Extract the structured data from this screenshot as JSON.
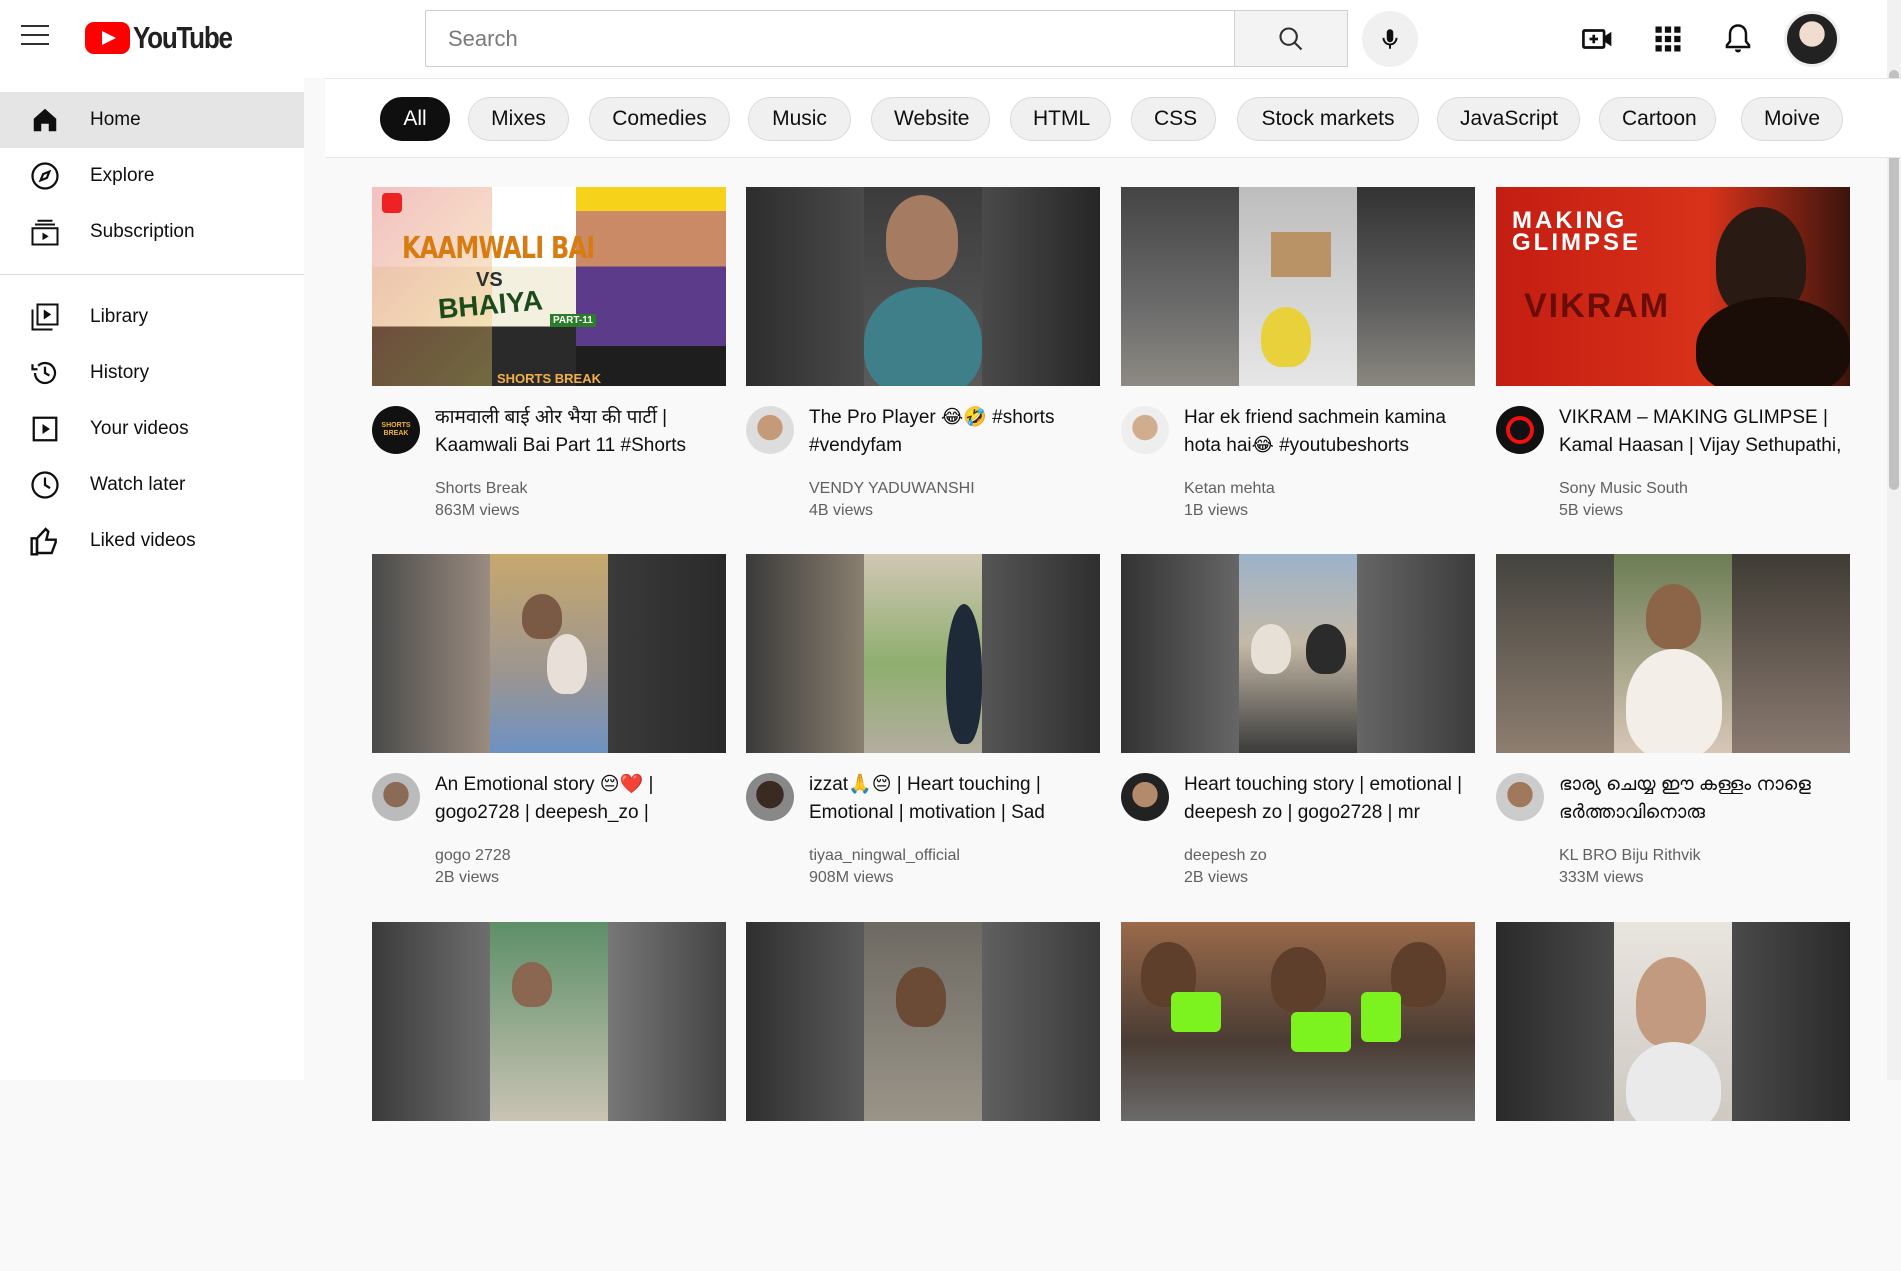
{
  "app": {
    "logo_text": "YouTube",
    "brand_color": "#ff0000"
  },
  "header": {
    "search_placeholder": "Search",
    "icons": [
      "menu-icon",
      "search-icon",
      "microphone-icon",
      "create-video-icon",
      "apps-grid-icon",
      "notifications-bell-icon",
      "account-avatar"
    ]
  },
  "sidebar": {
    "items": [
      {
        "label": "Home",
        "icon": "home-icon",
        "active": true
      },
      {
        "label": "Explore",
        "icon": "compass-icon"
      },
      {
        "label": "Subscription",
        "icon": "subscriptions-icon"
      },
      {
        "label": "Library",
        "icon": "library-icon"
      },
      {
        "label": "History",
        "icon": "history-icon"
      },
      {
        "label": "Your videos",
        "icon": "your-videos-icon"
      },
      {
        "label": "Watch later",
        "icon": "clock-icon"
      },
      {
        "label": "Liked videos",
        "icon": "thumbs-up-icon"
      }
    ]
  },
  "chips": [
    {
      "label": "All",
      "active": true
    },
    {
      "label": "Mixes"
    },
    {
      "label": "Comedies"
    },
    {
      "label": "Music"
    },
    {
      "label": "Website"
    },
    {
      "label": "HTML"
    },
    {
      "label": "CSS"
    },
    {
      "label": "Stock markets"
    },
    {
      "label": "JavaScript"
    },
    {
      "label": "Cartoon"
    },
    {
      "label": "Moive"
    }
  ],
  "videos": [
    {
      "title": "कामवाली बाई ओर भैया की पार्टी | Kaamwali Bai Part 11 #Shorts",
      "channel": "Shorts Break",
      "views": "863M views",
      "thumb_text": [
        "KAAMWALI BAI",
        "VS",
        "BHAIYA",
        "PART-11",
        "SHORTS BREAK"
      ],
      "avatar_text": "SHORTS BREAK"
    },
    {
      "title": "The Pro Player 😂🤣 #shorts #vendyfam",
      "channel": "VENDY YADUWANSHI",
      "views": "4B views"
    },
    {
      "title": "Har ek friend sachmein kamina hota hai😂 #youtubeshorts",
      "channel": "Ketan mehta",
      "views": "1B views"
    },
    {
      "title": "VIKRAM – MAKING GLIMPSE | Kamal Haasan | Vijay Sethupathi,",
      "channel": "Sony Music South",
      "views": "5B views",
      "thumb_text": [
        "MAKING",
        "GLIMPSE",
        "VIKRAM"
      ]
    },
    {
      "title": "An Emotional story 😔❤️ | gogo2728 | deepesh_zo |",
      "channel": "gogo 2728",
      "views": "2B views"
    },
    {
      "title": "izzat🙏😔 | Heart touching | Emotional | motivation | Sad",
      "channel": "tiyaa_ningwal_official",
      "views": "908M views"
    },
    {
      "title": "Heart touching story | emotional | deepesh zo | gogo2728 | mr",
      "channel": "deepesh zo",
      "views": "2B views"
    },
    {
      "title": "ഭാര്യ ചെയ്യ ഈ കള്ളം നാളെ ഭർത്താവിനൊരു",
      "channel": "KL BRO Biju Rithvik",
      "views": "333M views"
    },
    {
      "title": "",
      "channel": "",
      "views": ""
    },
    {
      "title": "",
      "channel": "",
      "views": ""
    },
    {
      "title": "",
      "channel": "",
      "views": ""
    },
    {
      "title": "",
      "channel": "",
      "views": ""
    }
  ]
}
